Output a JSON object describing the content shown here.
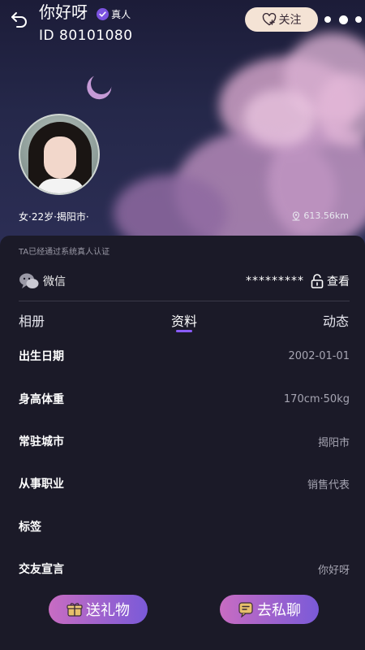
{
  "header": {
    "name": "你好呀",
    "verified_label": "真人",
    "id_text": "ID 80101080",
    "follow_label": "关注"
  },
  "profile": {
    "summary": "女·22岁·揭阳市·",
    "distance": "613.56km"
  },
  "verification_note": "TA已经通过系统真人认证",
  "wechat": {
    "label": "微信",
    "value": "*********",
    "action": "查看"
  },
  "tabs": [
    {
      "label": "相册"
    },
    {
      "label": "资料"
    },
    {
      "label": "动态"
    }
  ],
  "active_tab": "资料",
  "info": [
    {
      "label": "出生日期",
      "value": "2002-01-01"
    },
    {
      "label": "身高体重",
      "value": "170cm·50kg"
    },
    {
      "label": "常驻城市",
      "value": "揭阳市"
    },
    {
      "label": "从事职业",
      "value": "销售代表"
    },
    {
      "label": "标签",
      "value": ""
    },
    {
      "label": "交友宣言",
      "value": "你好呀"
    }
  ],
  "actions": {
    "gift_label": "送礼物",
    "chat_label": "去私聊"
  },
  "colors": {
    "accent": "#8a5cff",
    "follow_bg": "#f4e3d5",
    "panel_bg": "#1b1a28",
    "button_gradient_start": "#c86cc2",
    "button_gradient_end": "#7a5ad8"
  },
  "icons": [
    "back-icon",
    "verified-icon",
    "heart-plus-icon",
    "more-icon",
    "location-icon",
    "wechat-icon",
    "lock-icon",
    "gift-icon",
    "chat-icon"
  ]
}
